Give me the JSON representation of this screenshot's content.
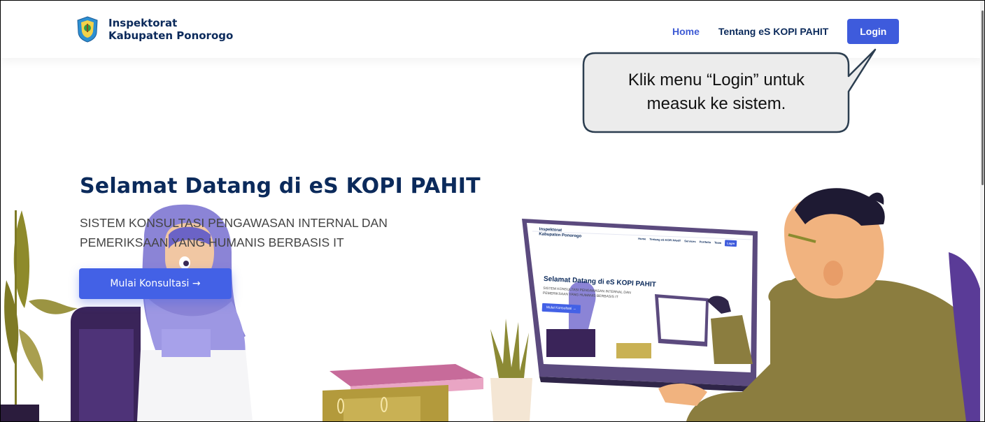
{
  "brand": {
    "line1": "Inspektorat",
    "line2": "Kabupaten Ponorogo",
    "logo_icon": "ponorogo-crest-icon"
  },
  "nav": {
    "home": "Home",
    "about": "Tentang eS KOPI PAHIT",
    "login": "Login"
  },
  "hero": {
    "title_part1": "Selamat Datang di eS ",
    "title_part2": "KOPI",
    "title_part3": " PAHIT",
    "subtitle_line1": "SISTEM KONSULTASI PENGAWASAN INTERNAL DAN",
    "subtitle_line2": "PEMERIKSAAN YANG HUMANIS BERBASIS IT",
    "cta_label": "Mulai Konsultasi →"
  },
  "callout": {
    "line1": "Klik menu “Login” untuk",
    "line2": "measuk ke sistem."
  },
  "monitor_screen": {
    "brand_line1": "Inspektorat",
    "brand_line2": "Kabupaten Ponorogo",
    "nav_items": [
      "Home",
      "Tentang eS KOPI PAHIT",
      "Services",
      "Portfolio",
      "Team"
    ],
    "login": "Login",
    "title": "Selamat Datang di eS KOPI PAHIT",
    "subtitle_line1": "SISTEM KONSULTASI PENGAWASAN INTERNAL DAN",
    "subtitle_line2": "PEMERIKSAAN YANG HUMANIS BERBASIS IT",
    "cta": "Mulai Konsultasi →"
  },
  "colors": {
    "primary": "#3e5bdc",
    "navy": "#0b2a5b",
    "purple": "#5a3b97",
    "olive": "#8b7d3f"
  }
}
